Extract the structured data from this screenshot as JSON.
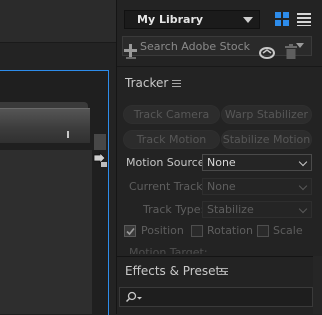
{
  "library": {
    "name": "My Library",
    "search_placeholder": "Search Adobe Stock"
  },
  "tracker": {
    "title": "Tracker",
    "buttons": {
      "track_camera": "Track Camera",
      "warp_stabilizer": "Warp Stabilizer",
      "track_motion": "Track Motion",
      "stabilize_motion": "Stabilize Motion"
    },
    "motion_source": {
      "label": "Motion Source:",
      "value": "None"
    },
    "current_track": {
      "label": "Current Track:",
      "value": "None"
    },
    "track_type": {
      "label": "Track Type:",
      "value": "Stabilize"
    },
    "checkboxes": {
      "position": {
        "label": "Position",
        "checked": true
      },
      "rotation": {
        "label": "Rotation",
        "checked": false
      },
      "scale": {
        "label": "Scale",
        "checked": false
      }
    },
    "motion_target": {
      "label": "Motion Target:"
    }
  },
  "effects": {
    "title": "Effects & Presets"
  },
  "colors": {
    "panel_bg": "#232323",
    "active_border": "#2d8ceb",
    "grid_icon": "#2d8ceb",
    "disabled_text": "#5e5e5e"
  },
  "icons": [
    "grid-view-icon",
    "list-view-icon",
    "add-icon",
    "sync-icon",
    "trash-icon",
    "hamburger-menu-icon",
    "search-icon",
    "chevron-down-icon",
    "drag-handle-icon",
    "checkmark-icon"
  ]
}
